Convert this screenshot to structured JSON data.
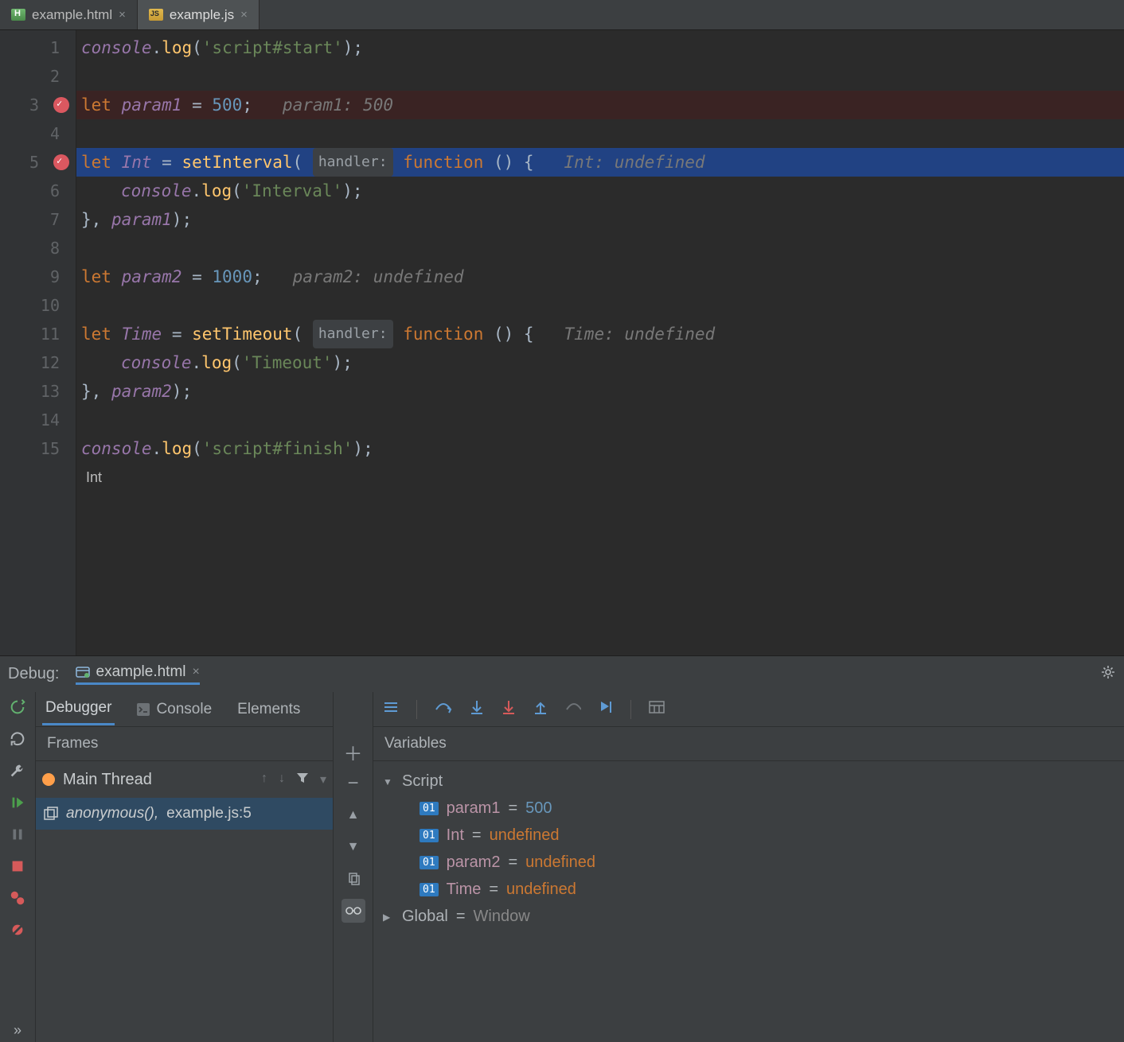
{
  "tabs": [
    {
      "label": "example.html",
      "icon": "html"
    },
    {
      "label": "example.js",
      "icon": "js",
      "active": true
    }
  ],
  "code": {
    "l1": {
      "obj": "console",
      "fn": "log",
      "str": "'script#start'"
    },
    "l3": {
      "kw": "let",
      "name": "param1",
      "val": "500",
      "hint": "param1: 500"
    },
    "l5": {
      "kw": "let",
      "name": "Int",
      "fn": "setInterval",
      "badge": "handler:",
      "fkw": "function",
      "hint": "Int: undefined"
    },
    "l6": {
      "obj": "console",
      "fn": "log",
      "str": "'Interval'"
    },
    "l7": {
      "close": "}, ",
      "arg": "param1",
      "end": ");"
    },
    "l9": {
      "kw": "let",
      "name": "param2",
      "val": "1000",
      "hint": "param2: undefined"
    },
    "l11": {
      "kw": "let",
      "name": "Time",
      "fn": "setTimeout",
      "badge": "handler:",
      "fkw": "function",
      "hint": "Time: undefined"
    },
    "l12": {
      "obj": "console",
      "fn": "log",
      "str": "'Timeout'"
    },
    "l13": {
      "close": "}, ",
      "arg": "param2",
      "end": ");"
    },
    "l15": {
      "obj": "console",
      "fn": "log",
      "str": "'script#finish'"
    },
    "cursor": "Int"
  },
  "debug": {
    "label": "Debug:",
    "session": "example.html",
    "tabs": {
      "debugger": "Debugger",
      "console": "Console",
      "elements": "Elements"
    },
    "frames_label": "Frames",
    "variables_label": "Variables",
    "thread": "Main Thread",
    "frame": {
      "name": "anonymous",
      "loc": "example.js:5"
    },
    "scopes": {
      "script": {
        "label": "Script",
        "vars": [
          {
            "name": "param1",
            "value": "500",
            "type": "num"
          },
          {
            "name": "Int",
            "value": "undefined",
            "type": "undef"
          },
          {
            "name": "param2",
            "value": "undefined",
            "type": "undef"
          },
          {
            "name": "Time",
            "value": "undefined",
            "type": "undef"
          }
        ]
      },
      "global": {
        "label": "Global",
        "value": "Window"
      }
    }
  }
}
